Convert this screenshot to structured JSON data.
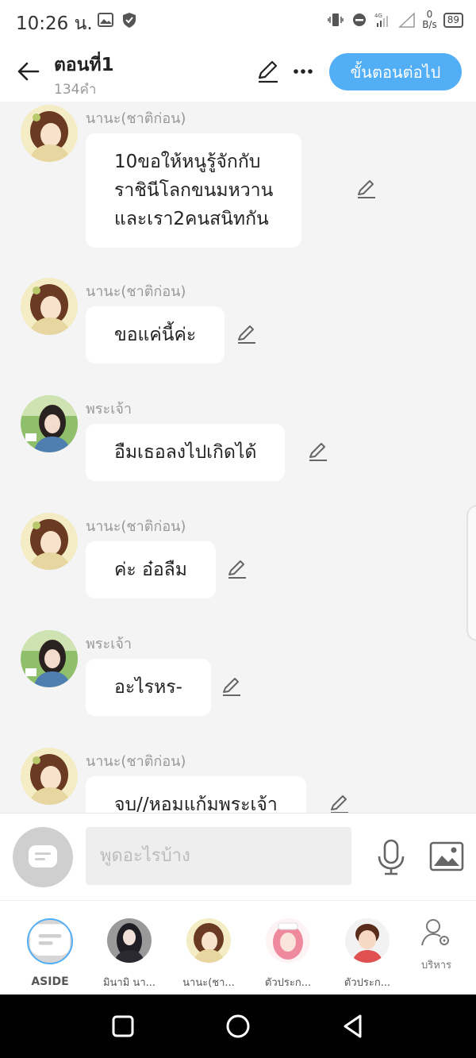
{
  "status_bar": {
    "time": "10:26 น.",
    "net_speed": "0",
    "net_unit": "B/s",
    "battery": "89",
    "signal_label": "4G"
  },
  "header": {
    "title": "ตอนที่1",
    "word_count": "134คำ",
    "next_button": "ขั้นตอนต่อไป"
  },
  "messages": [
    {
      "sender": "นานะ(ชาติก่อน)",
      "text": "10ขอให้หนูรู้จักกับ\nราชินีโลกขนมหวาน\nและเรา2คนสนิทกัน",
      "avatar": "nana"
    },
    {
      "sender": "นานะ(ชาติก่อน)",
      "text": "ขอแค่นี้ค่ะ",
      "avatar": "nana"
    },
    {
      "sender": "พระเจ้า",
      "text": "อืมเธอลงไปเกิดได้",
      "avatar": "god"
    },
    {
      "sender": "นานะ(ชาติก่อน)",
      "text": "ค่ะ อ๋อลืม",
      "avatar": "nana"
    },
    {
      "sender": "พระเจ้า",
      "text": "อะไรหร-",
      "avatar": "god"
    },
    {
      "sender": "นานะ(ชาติก่อน)",
      "text": "จบ//หอมแก้มพระเจ้า",
      "avatar": "nana"
    }
  ],
  "input": {
    "placeholder": "พูดอะไรบ้าง"
  },
  "characters": [
    {
      "name": "ASIDE"
    },
    {
      "name": "มินามิ นา..."
    },
    {
      "name": "นานะ(ชา..."
    },
    {
      "name": "ตัวประก..."
    },
    {
      "name": "ตัวประก..."
    }
  ],
  "manage_label": "บริหาร",
  "colors": {
    "accent": "#52aef5",
    "background": "#f4f4f4",
    "bubble": "#ffffff"
  }
}
